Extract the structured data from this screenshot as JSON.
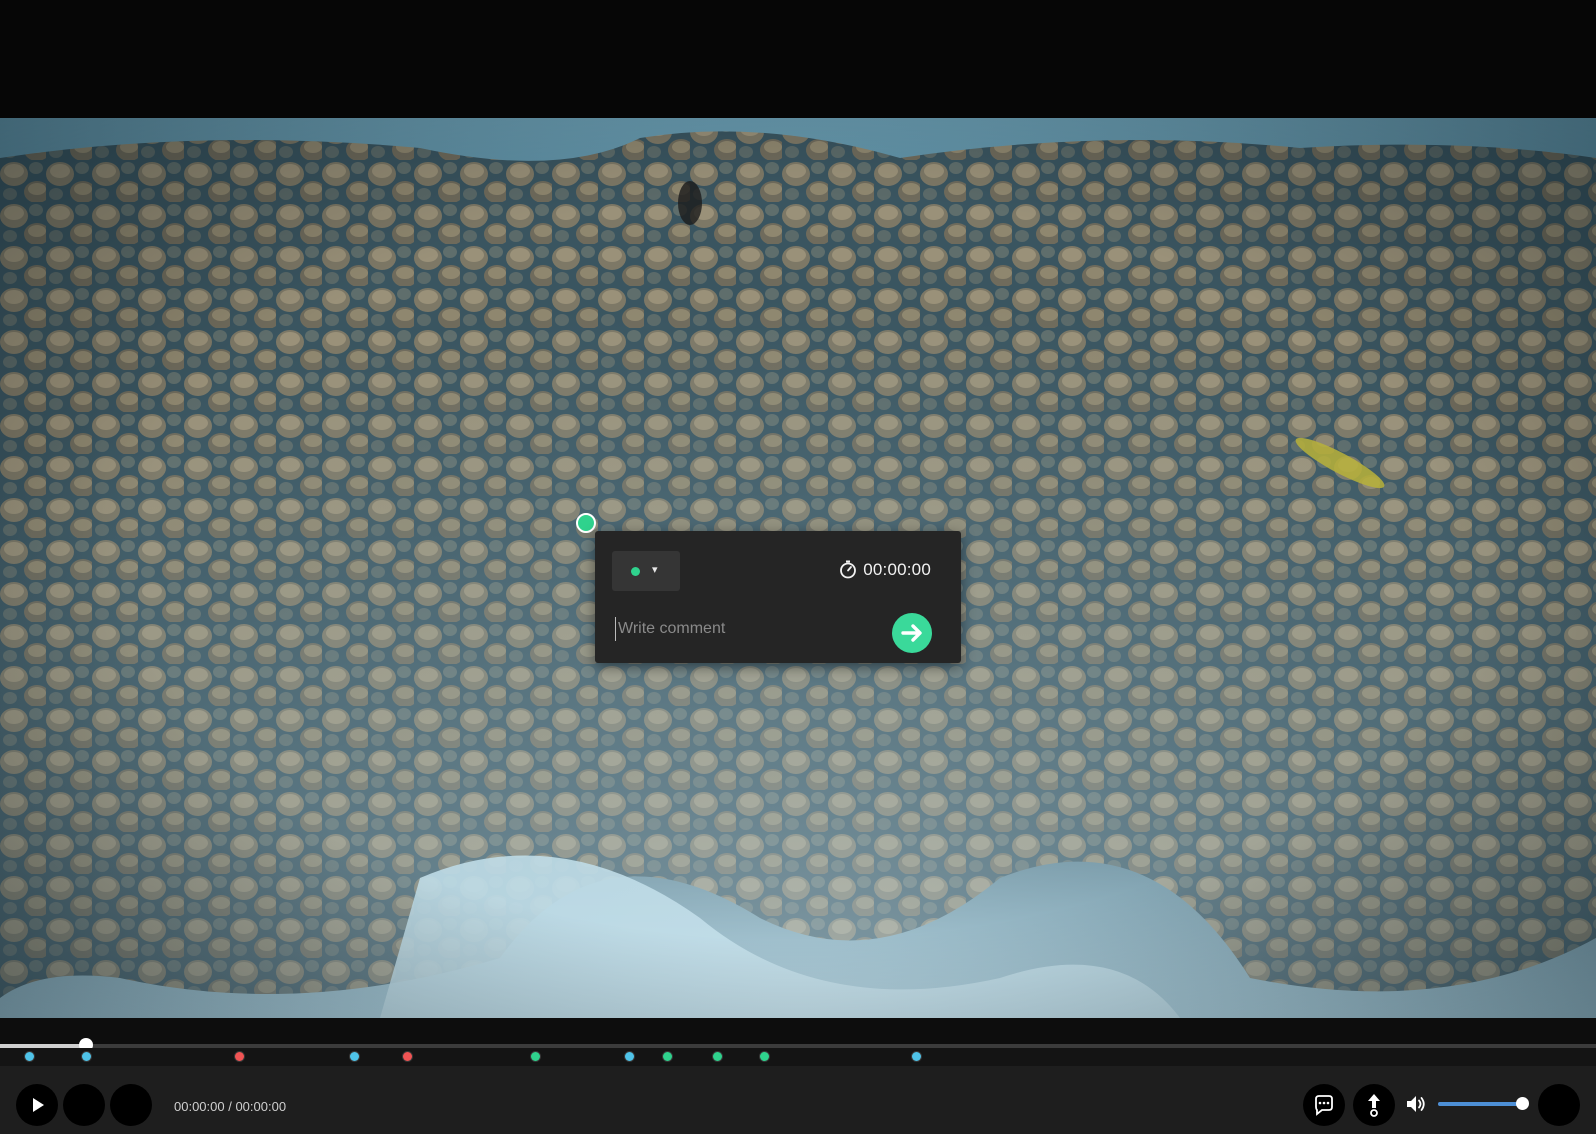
{
  "video": {
    "comment_marker_color": "#2fd28d"
  },
  "comment_popover": {
    "selected_color": "#2fd28d",
    "color_caret": "▾",
    "timestamp": "00:00:00",
    "input_placeholder": "Write comment",
    "input_value": "",
    "send_icon": "arrow-right-icon",
    "send_color": "#3ad99a"
  },
  "timeline": {
    "progress_fraction": 0.054,
    "markers": [
      {
        "position": 0.018,
        "color": "#4fc3e8"
      },
      {
        "position": 0.054,
        "color": "#4fc3e8"
      },
      {
        "position": 0.15,
        "color": "#f05454"
      },
      {
        "position": 0.222,
        "color": "#4fc3e8"
      },
      {
        "position": 0.255,
        "color": "#f05454"
      },
      {
        "position": 0.335,
        "color": "#2fd28d"
      },
      {
        "position": 0.394,
        "color": "#4fc3e8"
      },
      {
        "position": 0.418,
        "color": "#2fd28d"
      },
      {
        "position": 0.449,
        "color": "#2fd28d"
      },
      {
        "position": 0.479,
        "color": "#2fd28d"
      },
      {
        "position": 0.574,
        "color": "#4fc3e8"
      }
    ]
  },
  "controls": {
    "time_display": "00:00:00 / 00:00:00",
    "volume_fraction": 0.95,
    "icons": {
      "play": "play-icon",
      "comments": "comment-icon",
      "annotate": "pin-icon",
      "volume": "volume-icon"
    }
  }
}
